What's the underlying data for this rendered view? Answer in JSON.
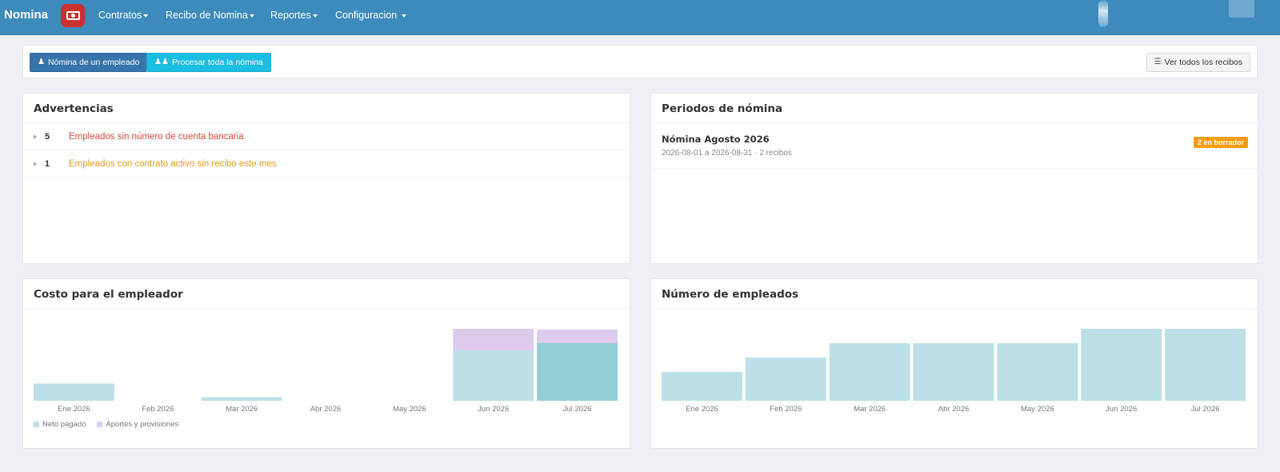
{
  "navbar": {
    "brand": "Nomina",
    "menu": [
      {
        "label": "Contratos"
      },
      {
        "label": "Recibo de Nomina"
      },
      {
        "label": "Reportes"
      },
      {
        "label": "Configuracion"
      }
    ]
  },
  "toolbar": {
    "single_label": "Nómina de un empleado",
    "all_label": "Procesar toda la nómina",
    "view_all_label": "Ver todos los recibos"
  },
  "warnings": {
    "title": "Advertencias",
    "items": [
      {
        "count": "5",
        "text": "Empleados sin número de cuenta bancaria",
        "color": "#d24b3e"
      },
      {
        "count": "1",
        "text": "Empleados con contrato activo sin recibo este mes",
        "color": "#e09a1e"
      }
    ]
  },
  "periods": {
    "title": "Periodos de nómina",
    "items": [
      {
        "name": "Nómina Agosto 2026",
        "range": "2026-08-01 a 2026-08-31 · 2 recibos",
        "badge": "2 en borrador"
      }
    ]
  },
  "colors": {
    "navbar": "#3d8bbd",
    "primary": "#3674ab",
    "info": "#1cbde2",
    "bar_teal": "#bce0e5",
    "bar_teal_dark": "#93cdd6",
    "bar_lilac": "#dccbea",
    "badge": "#f39c12"
  },
  "cost_chart": {
    "title": "Costo para el empleador",
    "legend": [
      "Neto pagado",
      "Aportes y provisiones"
    ]
  },
  "emp_chart": {
    "title": "Número de empleados"
  },
  "chart_data": [
    {
      "type": "bar",
      "stacked": true,
      "title": "Costo para el empleador",
      "categories": [
        "Ene 2026",
        "Feb 2026",
        "Mar 2026",
        "Abr 2026",
        "May 2026",
        "Jun 2026",
        "Jul 2026"
      ],
      "series": [
        {
          "name": "Neto pagado",
          "values": [
            0.24,
            0,
            0.05,
            0,
            0,
            0.7,
            0.8
          ]
        },
        {
          "name": "Aportes y provisiones",
          "values": [
            0,
            0,
            0,
            0,
            0,
            0.3,
            0.19
          ]
        }
      ],
      "ylim": [
        0,
        1
      ],
      "legend": "bottom-left"
    },
    {
      "type": "bar",
      "title": "Número de empleados",
      "categories": [
        "Ene 2026",
        "Feb 2026",
        "Mar 2026",
        "Abr 2026",
        "May 2026",
        "Jun 2026",
        "Jul 2026"
      ],
      "values": [
        2,
        3,
        4,
        4,
        4,
        5,
        5
      ],
      "ylim": [
        0,
        5
      ]
    }
  ]
}
